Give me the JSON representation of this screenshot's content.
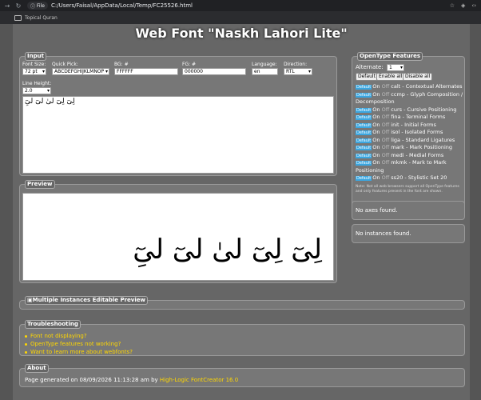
{
  "browser": {
    "file_label": "File",
    "url": "C:/Users/Faisal/AppData/Local/Temp/FC25526.html",
    "bookmark": "Topical Quran"
  },
  "title": "Web Font \"Naskh Lahori Lite\"",
  "input": {
    "legend": "Input",
    "font_size_label": "Font Size:",
    "font_size_value": "72 pt",
    "quick_pick_label": "Quick Pick:",
    "quick_pick_value": "ABCDEFGHIJKLMNOP",
    "bg_label": "BG: #",
    "bg_value": "FFFFFF",
    "fg_label": "FG: #",
    "fg_value": "000000",
    "language_label": "Language:",
    "language_value": "en",
    "direction_label": "Direction:",
    "direction_value": "RTL",
    "line_height_label": "Line Height:",
    "line_height_value": "2.0",
    "sample_text": "لِیٓ لِیٓ لیٰ لیٓ لیِٓ"
  },
  "preview": {
    "legend": "Preview",
    "text": "لِیٓ لِیٓ لیٰ لیٓ لیِٓ"
  },
  "opentype": {
    "legend": "OpenType Features",
    "alternate_label": "Alternate:",
    "alternate_value": "1",
    "buttons": [
      "Default",
      "Enable all",
      "Disable all"
    ],
    "tag_default": "Default",
    "on_label": "On",
    "off_label": "Off",
    "features": [
      {
        "code": "calt",
        "name": "Contextual Alternates"
      },
      {
        "code": "ccmp",
        "name": "Glyph Composition /"
      },
      {
        "code": "",
        "name": "Decomposition"
      },
      {
        "code": "curs",
        "name": "Cursive Positioning"
      },
      {
        "code": "fina",
        "name": "Terminal Forms"
      },
      {
        "code": "init",
        "name": "Initial Forms"
      },
      {
        "code": "isol",
        "name": "Isolated Forms"
      },
      {
        "code": "liga",
        "name": "Standard Ligatures"
      },
      {
        "code": "mark",
        "name": "Mark Positioning"
      },
      {
        "code": "medi",
        "name": "Medial Forms"
      },
      {
        "code": "mkmk",
        "name": "Mark to Mark"
      },
      {
        "code": "",
        "name": "Positioning"
      },
      {
        "code": "ss20",
        "name": "Stylistic Set 20"
      }
    ],
    "note": "Note: Not all web browsers support all OpenType features and only features present in the font are shown."
  },
  "axes": {
    "text": "No axes found."
  },
  "instances": {
    "text": "No instances found."
  },
  "multiple": {
    "legend": "Multiple Instances Editable Preview"
  },
  "troubleshooting": {
    "legend": "Troubleshooting",
    "links": [
      "Font not displaying?",
      "OpenType features not working?",
      "Want to learn more about webfonts?"
    ]
  },
  "about": {
    "legend": "About",
    "text": "Page generated on 08/09/2026 11:13:28 am by ",
    "link": "High-Logic FontCreator 16.0"
  }
}
